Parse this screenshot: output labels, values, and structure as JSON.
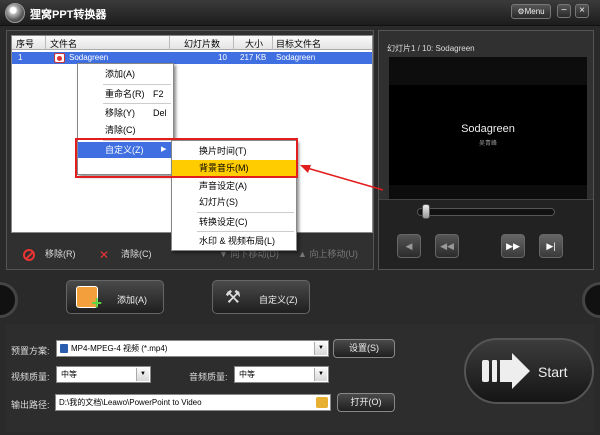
{
  "app": {
    "title": "狸窝PPT转换器",
    "menu_label": "Menu",
    "minimize_label": "−",
    "close_label": "×"
  },
  "table": {
    "columns": [
      "序号",
      "文件名",
      "幻灯片数",
      "大小",
      "目标文件名"
    ],
    "rows": [
      {
        "index": "1",
        "file_name": "Sodagreen",
        "slides": "10",
        "size": "217 KB",
        "target": "Sodagreen"
      }
    ]
  },
  "list_actions": {
    "remove": "移除(R)",
    "clear": "清除(C)",
    "move_down": "向下移动(D)",
    "move_up": "向上移动(U)"
  },
  "context_menu": {
    "add": "添加(A)",
    "rename": "重命名(R)",
    "rename_shortcut": "F2",
    "remove": "移除(Y)",
    "remove_shortcut": "Del",
    "clear": "清除(C)",
    "customize": "自定义(Z)"
  },
  "submenu": {
    "transition_time": "换片时间(T)",
    "background_music": "背景音乐(M)",
    "audio_settings": "声音设定(A)",
    "slides": "幻灯片(S)",
    "convert_settings": "转换设定(C)",
    "watermark_layout": "水印 & 视频布局(L)"
  },
  "preview": {
    "title": "幻灯片1 / 10: Sodagreen",
    "slide_title": "Sodagreen",
    "slide_subtitle": "吴青峰"
  },
  "player": {
    "btn_prev": "◀",
    "btn_rewind": "◀◀",
    "btn_forward": "▶▶",
    "btn_next": "▶|"
  },
  "buttons": {
    "add": "添加(A)",
    "customize": "自定义(Z)",
    "settings": "设置(S)",
    "open": "打开(O)",
    "start": "Start"
  },
  "form": {
    "preset_label": "预置方案:",
    "preset_value": "MP4-MPEG-4 视频 (*.mp4)",
    "video_quality_label": "视频质量:",
    "video_quality_value": "中等",
    "audio_quality_label": "音频质量:",
    "audio_quality_value": "中等",
    "output_label": "输出路径:",
    "output_path": "D:\\我的文档\\Leawo\\PowerPoint to Video"
  },
  "colors": {
    "selection_blue": "#3f6fe0",
    "highlight_yellow": "#ffcc00",
    "annotation_red": "#e21d1d"
  }
}
